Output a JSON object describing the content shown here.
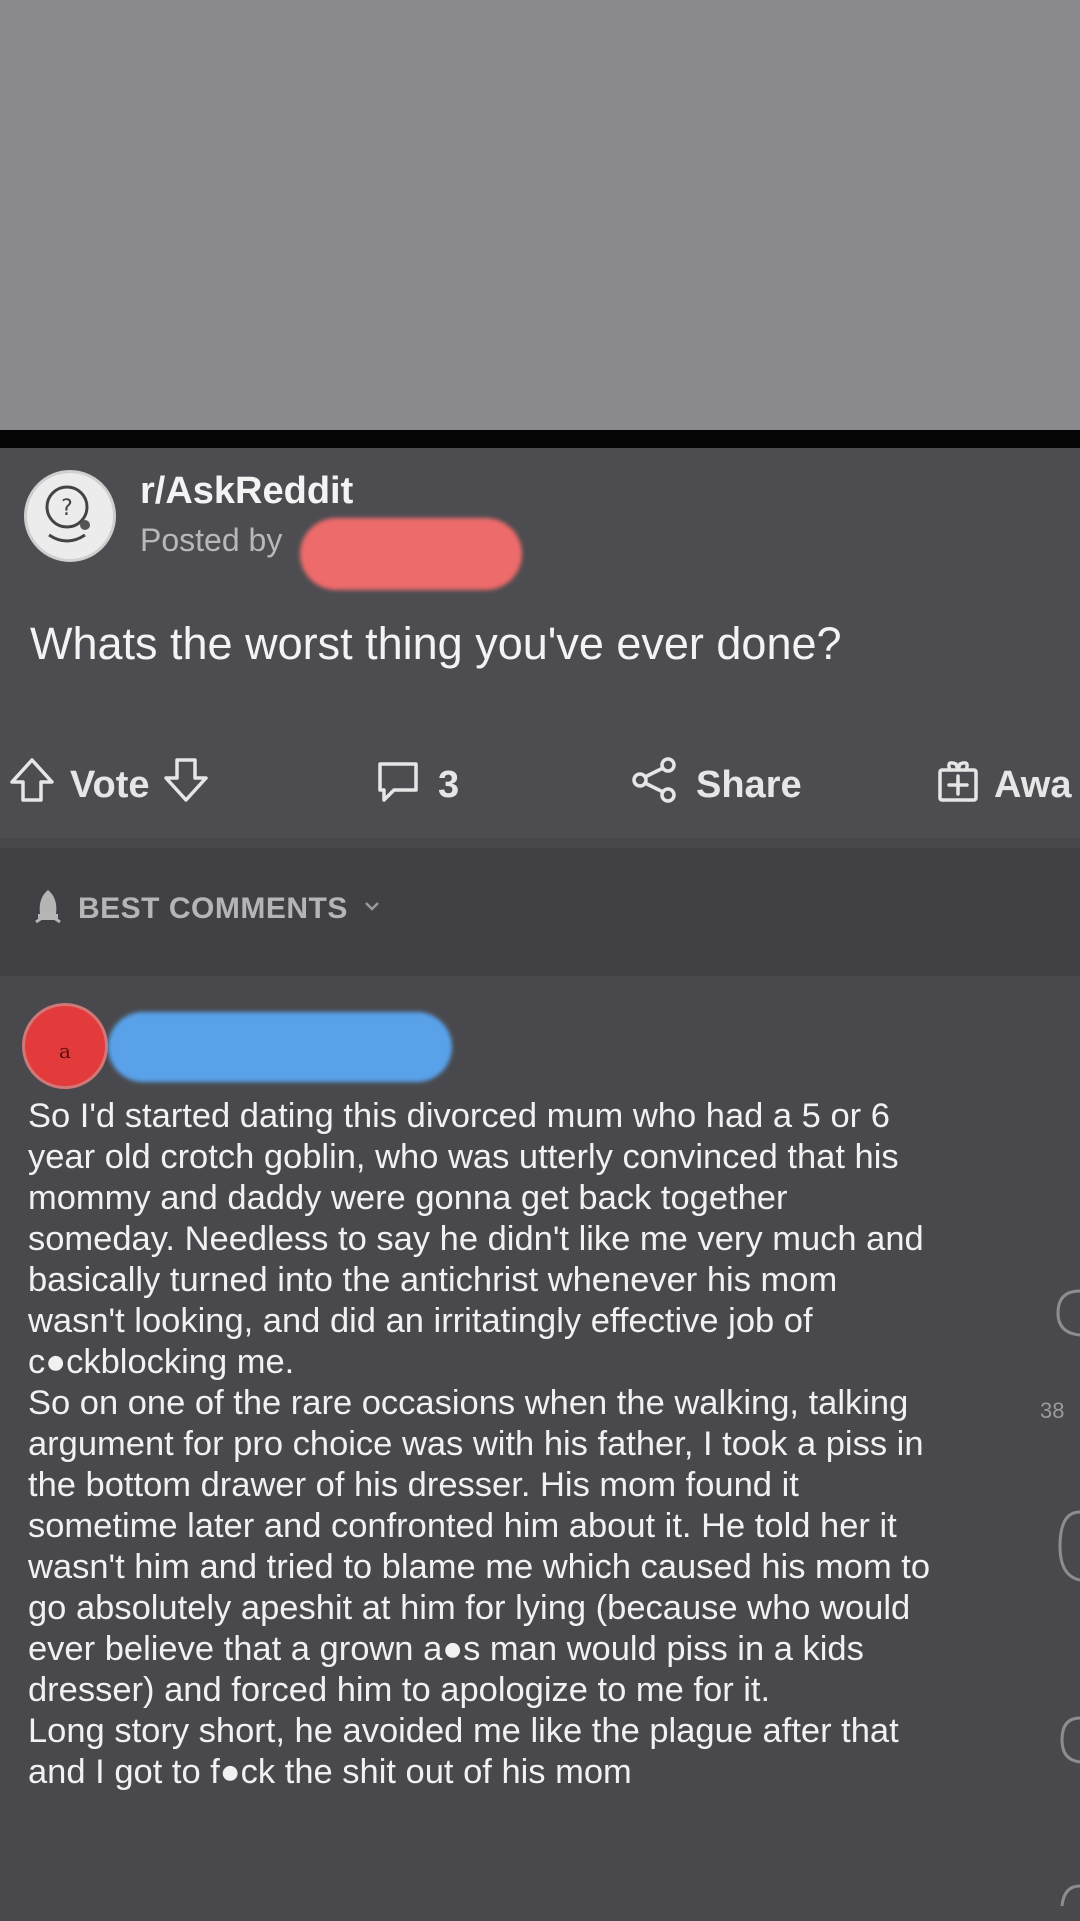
{
  "post": {
    "subreddit": "r/AskReddit",
    "posted_by": "Posted by",
    "title": "Whats the worst thing you've ever done?"
  },
  "actions": {
    "vote_label": "Vote",
    "comment_count": "3",
    "share_label": "Share",
    "award_label": "Awa"
  },
  "sort": {
    "label": "BEST COMMENTS"
  },
  "comment": {
    "avatar_letter": "a",
    "paragraphs": [
      "So I'd started dating this divorced mum who had a 5 or 6\nyear old crotch goblin, who was utterly convinced that his\nmommy and daddy were gonna get back together\nsomeday. Needless to say he didn't like me very much and\nbasically turned into the antichrist whenever his mom\nwasn't looking, and did an irritatingly effective job of\nc●ckblocking me.",
      "So on one of the rare occasions when the walking, talking\nargument for pro choice was with his father, I took a piss in\nthe bottom drawer of his dresser. His mom found it\nsometime later and confronted him about it. He told her it\nwasn't him and tried to blame me which caused his mom to\ngo absolutely apeshit at him for lying (because who would\never believe that a grown a●s man would piss in a kids\ndresser) and forced him to apologize to me for it.",
      "Long story short, he avoided me like the plague after that\nand I got to f●ck the shit out of his mom"
    ],
    "side_count": "38"
  },
  "colors": {
    "redact_red": "#ee6b6b",
    "redact_blue": "#59a2ea",
    "avatar_red": "#e33b3b"
  }
}
